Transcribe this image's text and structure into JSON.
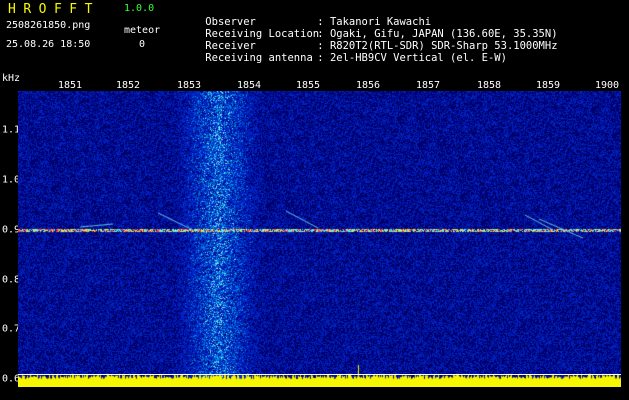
{
  "header": {
    "app_title": "HROFFT",
    "app_version": "1.0.0",
    "file_name": "2508261850.png",
    "meteor_label": "meteor",
    "capture_time": "25.08.26 18:50",
    "meteor_count": "0"
  },
  "station_info": [
    {
      "key": "Observer",
      "value": ": Takanori Kawachi"
    },
    {
      "key": "Receiving Location",
      "value": ": Ogaki, Gifu, JAPAN (136.60E, 35.35N)"
    },
    {
      "key": "Receiver",
      "value": ": R820T2(RTL-SDR) SDR-Sharp 53.1000MHz"
    },
    {
      "key": "Receiving antenna",
      "value": ": 2el-HB9CV Vertical (el. E-W)"
    }
  ],
  "axis": {
    "unit": "kHz",
    "x_ticks": [
      "1851",
      "1852",
      "1853",
      "1854",
      "1855",
      "1856",
      "1857",
      "1858",
      "1859",
      "1900"
    ],
    "y_ticks": [
      "1.1",
      "1.0",
      "0.9",
      "0.8",
      "0.7",
      "0.6"
    ]
  },
  "colors": {
    "header_yellow": "#f7f700",
    "header_green": "#39ff39",
    "noise_blue": "#0a1e8c",
    "signal_level_yellow": "#f7f700"
  }
}
